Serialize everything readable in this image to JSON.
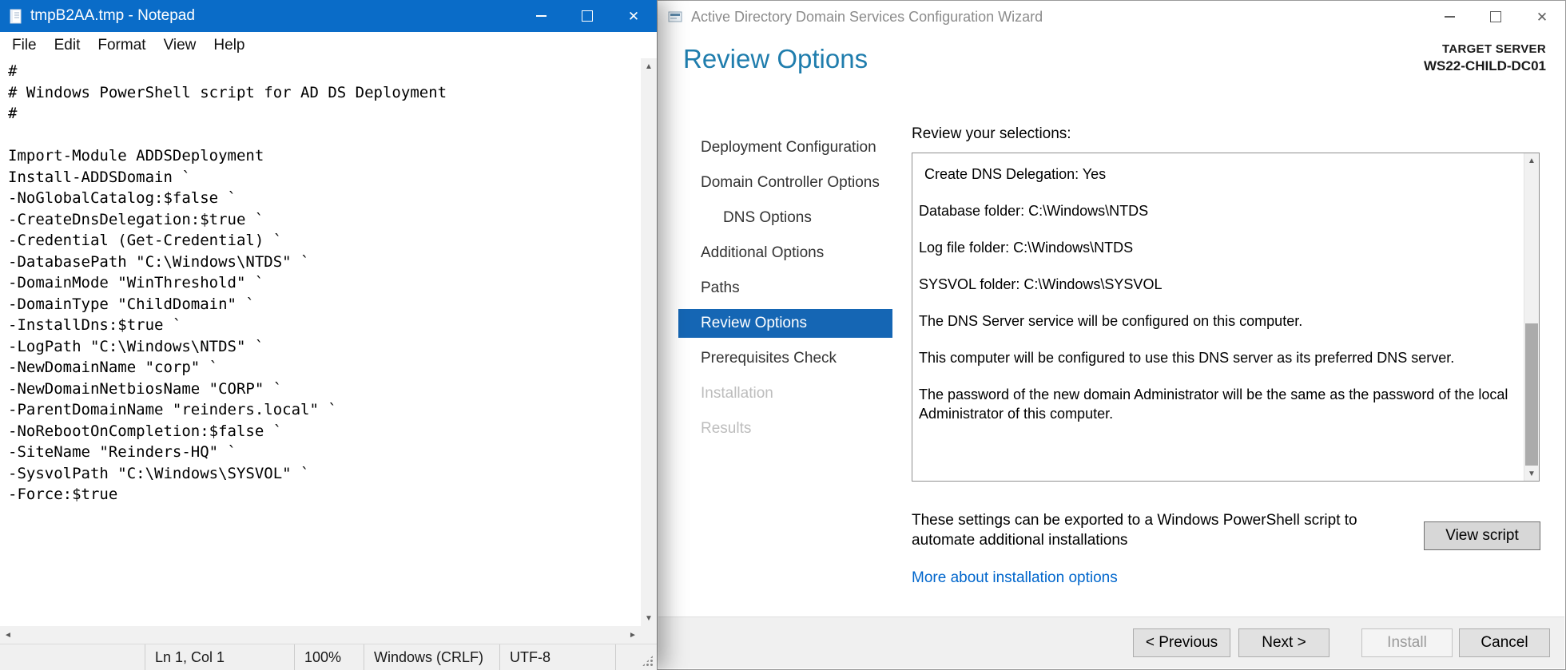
{
  "colors": {
    "titlebar_accent": "#0a6cc8",
    "nav_selected": "#1566b4",
    "header_teal": "#1f7dad",
    "link_blue": "#0066cc",
    "statusbar_gray": "#f0f0f0"
  },
  "notepad": {
    "title": "tmpB2AA.tmp - Notepad",
    "menus": [
      "File",
      "Edit",
      "Format",
      "View",
      "Help"
    ],
    "content_lines": [
      "#",
      "# Windows PowerShell script for AD DS Deployment",
      "#",
      "",
      "Import-Module ADDSDeployment",
      "Install-ADDSDomain `",
      "-NoGlobalCatalog:$false `",
      "-CreateDnsDelegation:$true `",
      "-Credential (Get-Credential) `",
      "-DatabasePath \"C:\\Windows\\NTDS\" `",
      "-DomainMode \"WinThreshold\" `",
      "-DomainType \"ChildDomain\" `",
      "-InstallDns:$true `",
      "-LogPath \"C:\\Windows\\NTDS\" `",
      "-NewDomainName \"corp\" `",
      "-NewDomainNetbiosName \"CORP\" `",
      "-ParentDomainName \"reinders.local\" `",
      "-NoRebootOnCompletion:$false `",
      "-SiteName \"Reinders-HQ\" `",
      "-SysvolPath \"C:\\Windows\\SYSVOL\" `",
      "-Force:$true"
    ],
    "status": {
      "cursor": "Ln 1, Col 1",
      "zoom": "100%",
      "eol": "Windows (CRLF)",
      "encoding": "UTF-8"
    }
  },
  "wizard": {
    "title": "Active Directory Domain Services Configuration Wizard",
    "page_title": "Review Options",
    "target_server_label": "TARGET SERVER",
    "target_server_name": "WS22-CHILD-DC01",
    "nav": [
      {
        "label": "Deployment Configuration",
        "state": "normal",
        "indent": false
      },
      {
        "label": "Domain Controller Options",
        "state": "normal",
        "indent": false
      },
      {
        "label": "DNS Options",
        "state": "normal",
        "indent": true
      },
      {
        "label": "Additional Options",
        "state": "normal",
        "indent": false
      },
      {
        "label": "Paths",
        "state": "normal",
        "indent": false
      },
      {
        "label": "Review Options",
        "state": "selected",
        "indent": false
      },
      {
        "label": "Prerequisites Check",
        "state": "normal",
        "indent": false
      },
      {
        "label": "Installation",
        "state": "disabled",
        "indent": false
      },
      {
        "label": "Results",
        "state": "disabled",
        "indent": false
      }
    ],
    "review_label": "Review your selections:",
    "review_lines": [
      "Create DNS Delegation: Yes",
      "Database folder: C:\\Windows\\NTDS",
      "Log file folder: C:\\Windows\\NTDS",
      "SYSVOL folder: C:\\Windows\\SYSVOL",
      "The DNS Server service will be configured on this computer.",
      "This computer will be configured to use this DNS server as its preferred DNS server.",
      "The password of the new domain Administrator will be the same as the password of the local Administrator of this computer."
    ],
    "export_note": "These settings can be exported to a Windows PowerShell script to automate additional installations",
    "view_script_button": "View script",
    "more_link": "More about installation options",
    "buttons": {
      "previous": "< Previous",
      "next": "Next >",
      "install": "Install",
      "cancel": "Cancel"
    }
  }
}
